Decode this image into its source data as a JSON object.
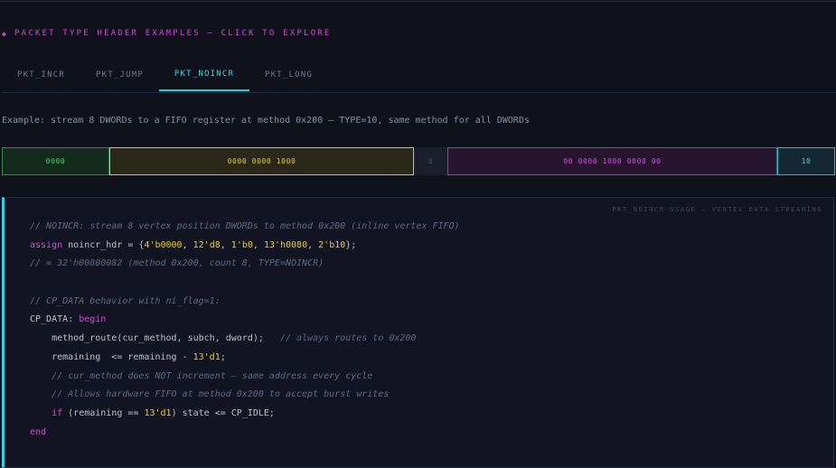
{
  "section": {
    "title": "PACKET TYPE HEADER EXAMPLES — CLICK TO EXPLORE",
    "icon": "diamond-icon"
  },
  "tabs": [
    {
      "label": "PKT_INCR",
      "active": false
    },
    {
      "label": "PKT_JUMP",
      "active": false
    },
    {
      "label": "PKT_NOINCR",
      "active": true
    },
    {
      "label": "PKT_LONG",
      "active": false
    }
  ],
  "example": "Example: stream 8 DWORDs to a FIFO register at method 0x200 — TYPE=10, same method for all DWORDs",
  "fields": [
    {
      "value": "0000",
      "color": "#44d46a"
    },
    {
      "value": "0000 0000 1000",
      "color": "#e6c93a"
    },
    {
      "value": "0",
      "color": "#4c5368"
    },
    {
      "value": "00 0000 1000 0000 00",
      "color": "#d34ae3"
    },
    {
      "value": "10",
      "color": "#43d6e4"
    }
  ],
  "code": {
    "caption": "PKT_NOINCR USAGE — VERTEX DATA STREAMING",
    "lines": [
      [
        [
          "cm",
          "// NOINCR: stream 8 vertex position DWORDs to method 0x200 (inline vertex FIFO)"
        ]
      ],
      [
        [
          "kw",
          "assign"
        ],
        [
          "txt",
          " noincr_hdr = {"
        ],
        [
          "num",
          "4'b0000"
        ],
        [
          "txt",
          ", "
        ],
        [
          "num",
          "12'd8"
        ],
        [
          "txt",
          ", "
        ],
        [
          "num",
          "1'b0"
        ],
        [
          "txt",
          ", "
        ],
        [
          "num",
          "13'h0080"
        ],
        [
          "txt",
          ", "
        ],
        [
          "num",
          "2'b10"
        ],
        [
          "txt",
          "};"
        ]
      ],
      [
        [
          "cm",
          "// = 32'h00800082 (method 0x200, count 8, TYPE=NOINCR)"
        ]
      ],
      [],
      [
        [
          "cm",
          "// CP_DATA behavior with ni_flag=1:"
        ]
      ],
      [
        [
          "txt",
          "CP_DATA: "
        ],
        [
          "kw",
          "begin"
        ]
      ],
      [
        [
          "txt",
          "    method_route(cur_method, subch, dword);   "
        ],
        [
          "cm",
          "// always routes to 0x200"
        ]
      ],
      [
        [
          "txt",
          "    remaining  <= remaining - "
        ],
        [
          "num",
          "13'd1"
        ],
        [
          "txt",
          ";"
        ]
      ],
      [
        [
          "txt",
          "    "
        ],
        [
          "cm",
          "// cur_method does NOT increment — same address every cycle"
        ]
      ],
      [
        [
          "txt",
          "    "
        ],
        [
          "cm",
          "// Allows hardware FIFO at method 0x200 to accept burst writes"
        ]
      ],
      [
        [
          "txt",
          "    "
        ],
        [
          "kw",
          "if"
        ],
        [
          "txt",
          " (remaining == "
        ],
        [
          "num",
          "13'd1"
        ],
        [
          "txt",
          ") state <= CP_IDLE;"
        ]
      ],
      [
        [
          "kw",
          "end"
        ]
      ]
    ]
  }
}
